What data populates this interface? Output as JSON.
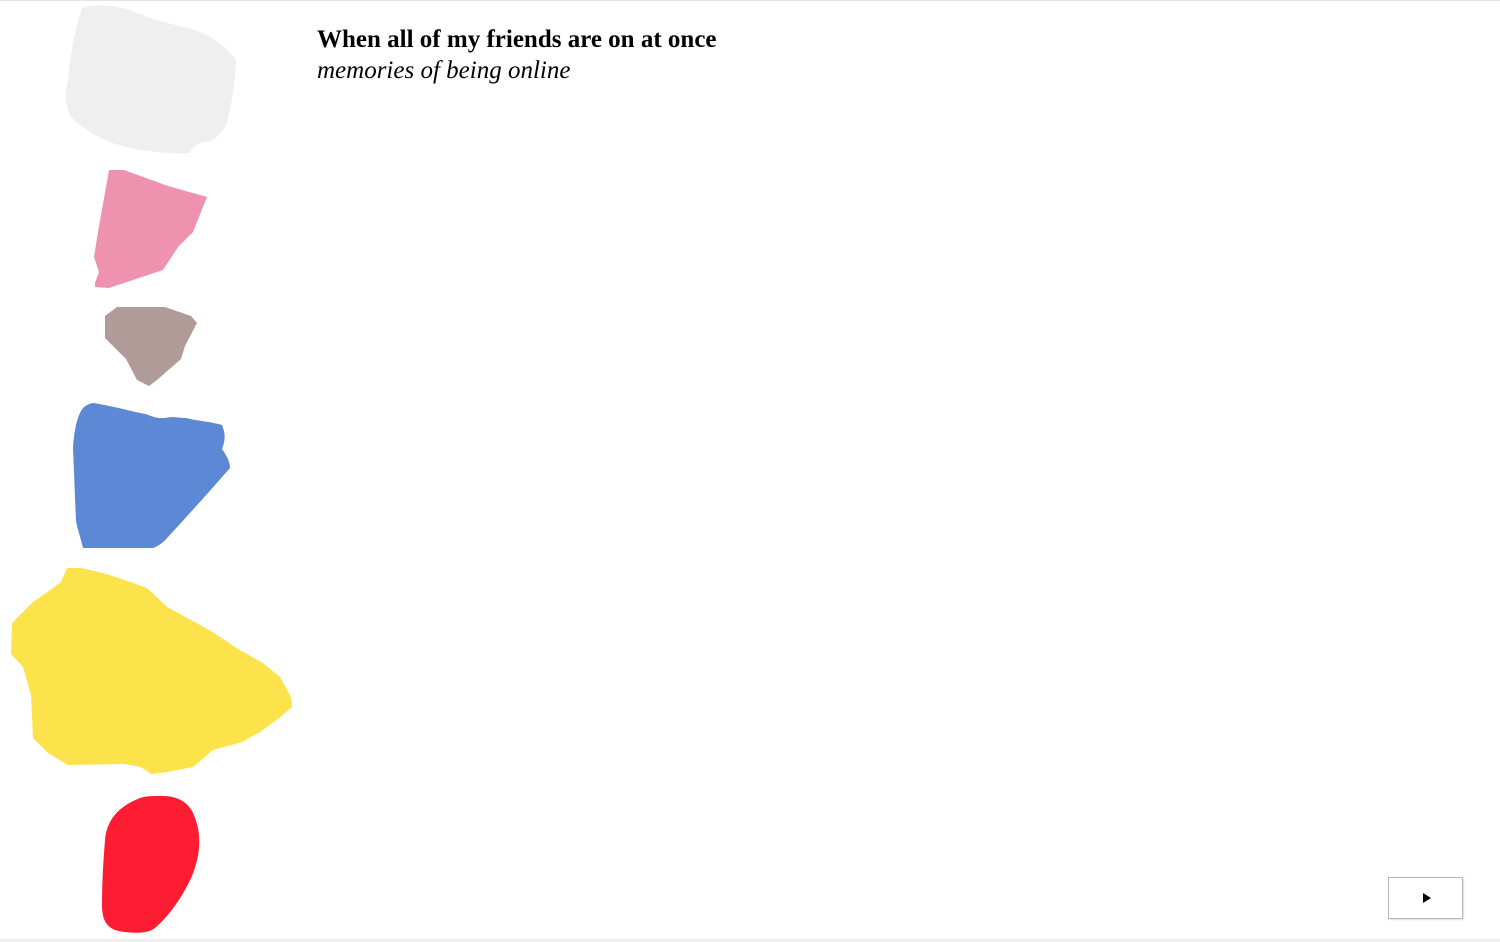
{
  "header": {
    "title": "When all of my friends are on at once",
    "subtitle": "memories of being online"
  },
  "friends": [
    {
      "name": "friend-1",
      "color": "#efefef"
    },
    {
      "name": "friend-2",
      "color": "#ee92b0"
    },
    {
      "name": "friend-3",
      "color": "#b09b98"
    },
    {
      "name": "friend-4",
      "color": "#5c88d6"
    },
    {
      "name": "friend-5",
      "color": "#fde34b"
    },
    {
      "name": "friend-6",
      "color": "#fc1d32"
    }
  ],
  "controls": {
    "play_icon": "play-icon"
  }
}
